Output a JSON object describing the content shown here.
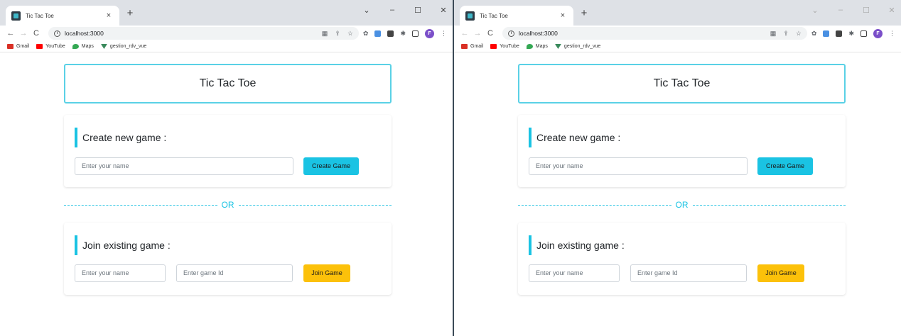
{
  "browser": {
    "tab_title": "Tic Tac Toe",
    "tab_close": "×",
    "new_tab": "+",
    "window_controls": [
      "⌄",
      "–",
      "☐",
      "✕"
    ],
    "back": "←",
    "forward": "→",
    "reload": "C",
    "url": "localhost:3000",
    "avatar_letter": "F",
    "bookmarks": [
      {
        "label": "Gmail",
        "icon": "gmail-icon",
        "color": "#d93025"
      },
      {
        "label": "YouTube",
        "icon": "youtube-icon",
        "color": "#ff0000"
      },
      {
        "label": "Maps",
        "icon": "maps-icon",
        "color": "#34a853"
      },
      {
        "label": "gestion_rdv_vue",
        "icon": "vue-icon",
        "color": "#3a8a5c"
      }
    ]
  },
  "app": {
    "title": "Tic Tac Toe",
    "create": {
      "heading": "Create new game :",
      "name_placeholder": "Enter your name",
      "button": "Create Game"
    },
    "or_label": "OR",
    "join": {
      "heading": "Join existing game :",
      "name_placeholder": "Enter your name",
      "game_id_placeholder": "Enter game Id",
      "button": "Join Game"
    }
  },
  "colors": {
    "accent": "#1ac3e3",
    "join_button": "#fcc10a",
    "title_border": "#5ad1e6",
    "window_divider": "#3c4a57"
  }
}
